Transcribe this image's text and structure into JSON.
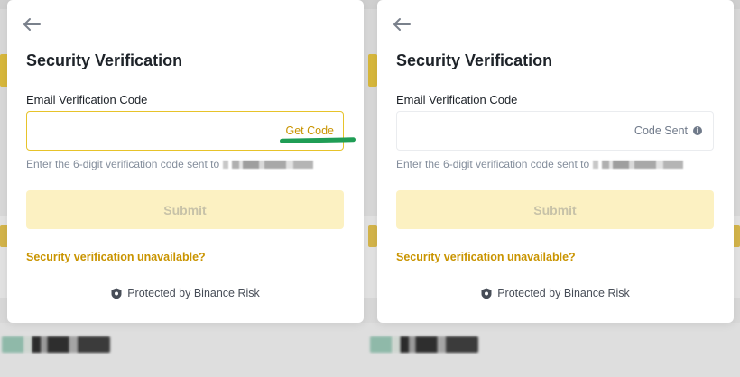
{
  "colors": {
    "accent": "#c99400",
    "input_focus_border": "#e7c32a",
    "submit_disabled_bg": "#fcf1c2",
    "annotation_underline": "#1f9d55",
    "text_primary": "#1e2329",
    "text_muted": "#848e9c"
  },
  "icons": {
    "back": "arrow-left-icon",
    "info": "info-icon",
    "protection": "shield-icon"
  },
  "modals": [
    {
      "title": "Security Verification",
      "field_label": "Email Verification Code",
      "input_value": "",
      "input_action": "Get Code",
      "helper_text": "Enter the 6-digit verification code sent to",
      "submit_label": "Submit",
      "unavailable_link": "Security verification unavailable?",
      "footer_text": "Protected by Binance Risk"
    },
    {
      "title": "Security Verification",
      "field_label": "Email Verification Code",
      "input_value": "",
      "input_status": "Code Sent",
      "helper_text": "Enter the 6-digit verification code sent to",
      "submit_label": "Submit",
      "unavailable_link": "Security verification unavailable?",
      "footer_text": "Protected by Binance Risk"
    }
  ]
}
